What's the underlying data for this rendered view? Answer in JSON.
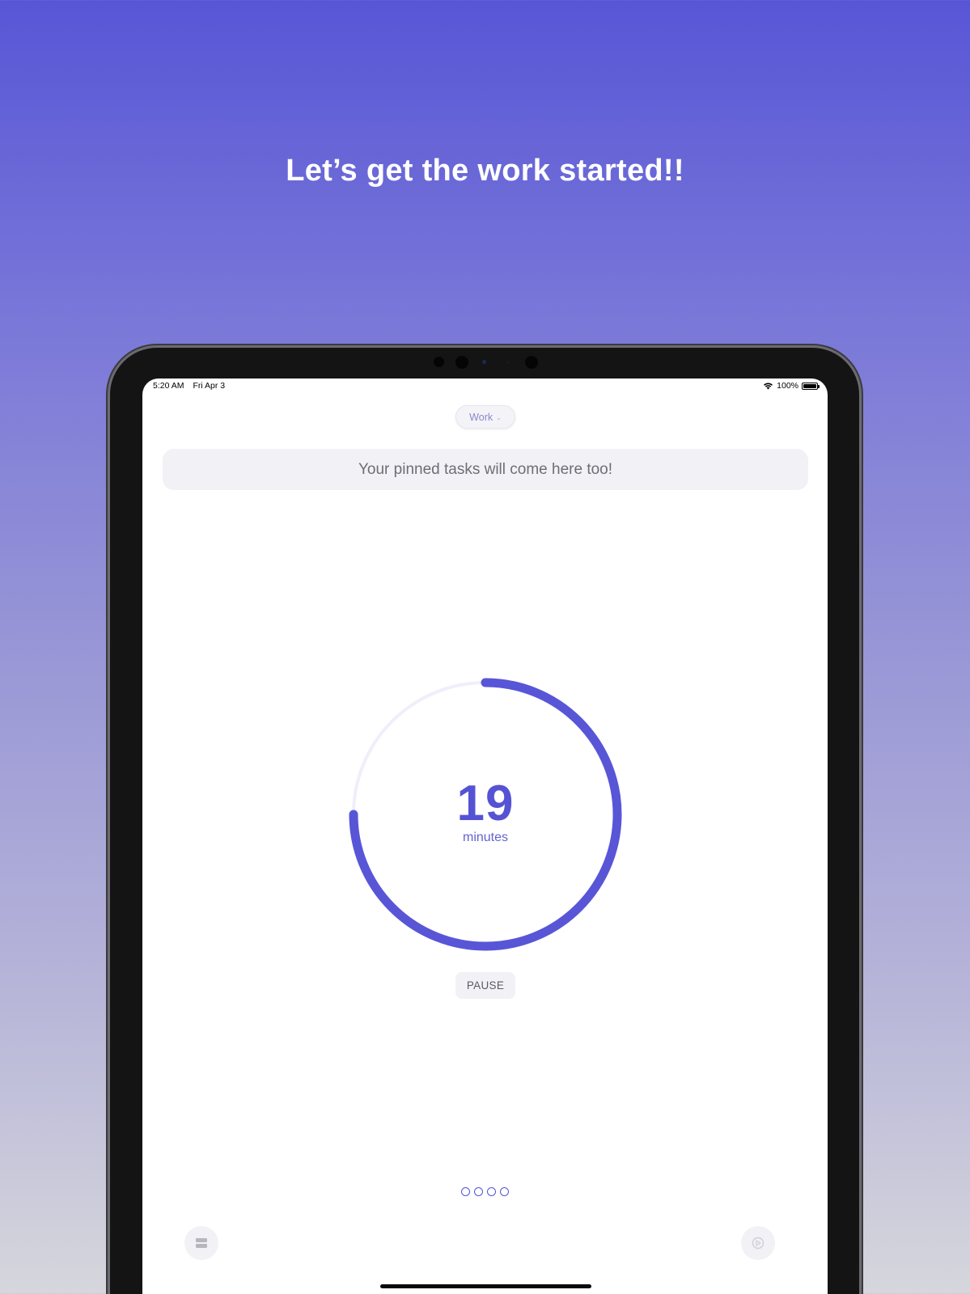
{
  "headline": "Let’s get the work started!!",
  "status_bar": {
    "time": "5:20 AM",
    "date": "Fri Apr 3",
    "battery": "100%"
  },
  "mode_selector": {
    "label": "Work"
  },
  "pinned_tasks": {
    "placeholder": "Your pinned tasks will come here too!"
  },
  "timer": {
    "value": "19",
    "unit": "minutes",
    "progress_fraction": 0.75
  },
  "pause_button": {
    "label": "PAUSE"
  },
  "page_indicator": {
    "count": 4
  },
  "icons": {
    "bottom_left": "list-icon",
    "bottom_right": "compass-icon"
  },
  "colors": {
    "accent": "#5856d6",
    "track": "#efeefb",
    "headline": "#ffffff"
  }
}
